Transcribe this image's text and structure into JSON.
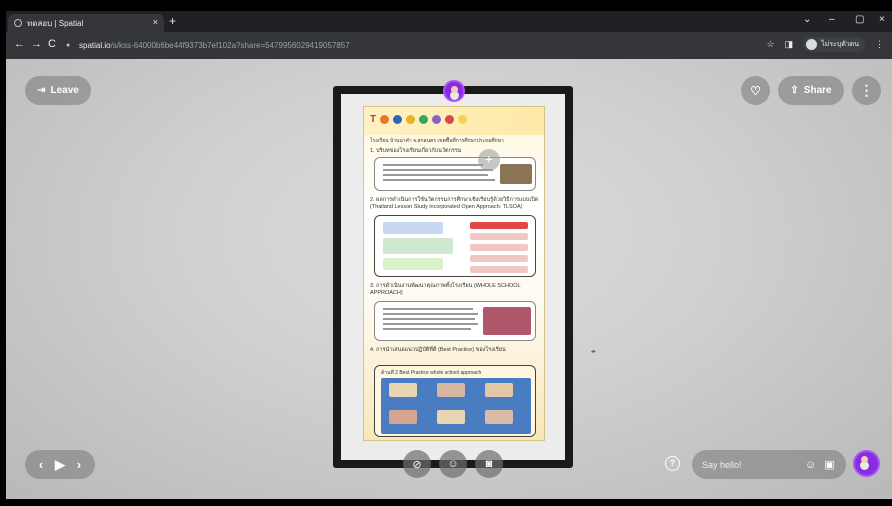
{
  "browser": {
    "tab_title": "ทดสอบ | Spatial",
    "tab_close": "×",
    "new_tab": "+",
    "url_host": "spatial.io",
    "url_path": "/s/kss-64000b6be44f9373b7ef102a?share=5479956029419057857",
    "profile_name": "ไม่ระบุตัวตน",
    "window_controls": [
      "⌄",
      "–",
      "▢",
      "×"
    ]
  },
  "scene": {
    "leave_label": "Leave",
    "share_label": "Share",
    "chat_placeholder": "Say hello!",
    "poster": {
      "brand": "T",
      "subtitle": "โรงเรียน บ้านนาคำ จ.สกลนคร เขตพื้นที่การศึกษาประถมศึกษา",
      "section1": "1. บริบทของโรงเรียนเกี่ยวกับนวัตกรรม",
      "section2": "2. ผลการดำเนินการใช้นวัตกรรมการศึกษาเชิงเรียนรู้ด้วยวิธีการแบบเปิด (Thailand Lesson Study incorporated Open Approach: TLSOA)",
      "section3": "3. การดำเนินงานพัฒนาคุณภาพทั้งโรงเรียน (WHOLE SCHOOL APPROACH)",
      "section4": "4. การนำเสนอแนวปฏิบัติที่ดี (Best Practice) ของโรงเรียน",
      "section5": "ด้านที่ 2 Best Practice whole school approach"
    }
  }
}
